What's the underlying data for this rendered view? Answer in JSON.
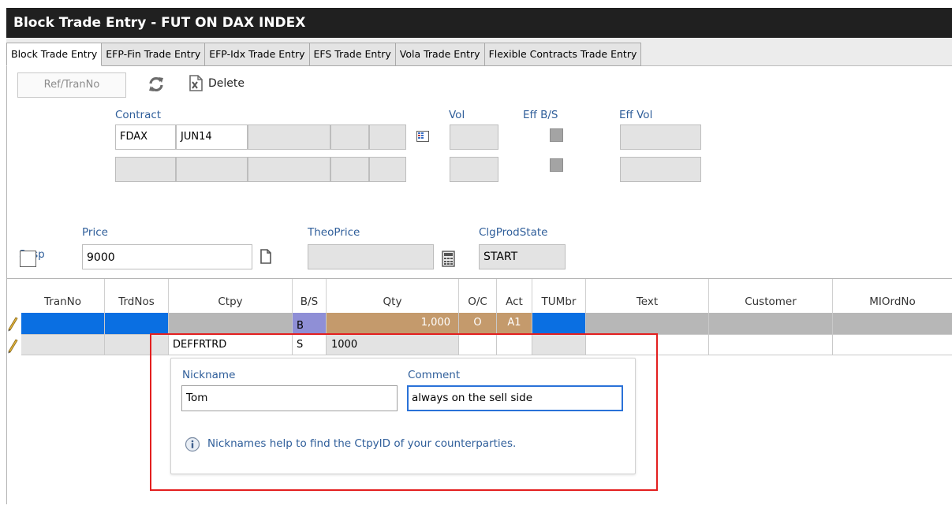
{
  "window": {
    "title": "Block Trade Entry - FUT ON DAX INDEX"
  },
  "tabs": [
    {
      "label": "Block Trade Entry",
      "active": true
    },
    {
      "label": "EFP-Fin Trade Entry",
      "active": false
    },
    {
      "label": "EFP-Idx Trade Entry",
      "active": false
    },
    {
      "label": "EFS Trade Entry",
      "active": false
    },
    {
      "label": "Vola Trade Entry",
      "active": false
    },
    {
      "label": "Flexible Contracts Trade Entry",
      "active": false
    }
  ],
  "toolbar": {
    "ref_tranno_label": "Ref/TranNo",
    "refresh_icon": "refresh-icon",
    "delete_icon": "delete-icon",
    "delete_label": "Delete"
  },
  "contract_section": {
    "contract_label": "Contract",
    "vol_label": "Vol",
    "eff_bs_label": "Eff B/S",
    "eff_vol_label": "Eff Vol",
    "product_value": "FDAX",
    "expiry_value": "JUN14"
  },
  "price_section": {
    "susp_label": "Susp",
    "price_label": "Price",
    "price_value": "9000",
    "theo_price_label": "TheoPrice",
    "clg_prod_state_label": "ClgProdState",
    "clg_prod_state_value": "START"
  },
  "grid": {
    "columns": [
      "TranNo",
      "TrdNos",
      "Ctpy",
      "B/S",
      "Qty",
      "O/C",
      "Act",
      "TUMbr",
      "Text",
      "Customer",
      "MIOrdNo"
    ],
    "rows": [
      {
        "bs": "B",
        "qty": "1,000",
        "oc": "O",
        "act": "A1",
        "selected": true
      },
      {
        "ctpy": "DEFFRTRD",
        "bs": "S",
        "qty": "1000",
        "selected": false
      }
    ]
  },
  "popup": {
    "nickname_label": "Nickname",
    "nickname_value": "Tom",
    "comment_label": "Comment",
    "comment_value": "always on the sell side",
    "info_text": "Nicknames help to find the CtpyID of your counterparties.",
    "info_icon": "info-icon"
  },
  "colors": {
    "title_bar": "#202020",
    "label_blue": "#2f5e9a",
    "row_selected": "#0a6fe2",
    "bs_buy": "#8f8fd6",
    "qty_buy": "#c49a6c",
    "highlight_red": "#e31f1f"
  }
}
